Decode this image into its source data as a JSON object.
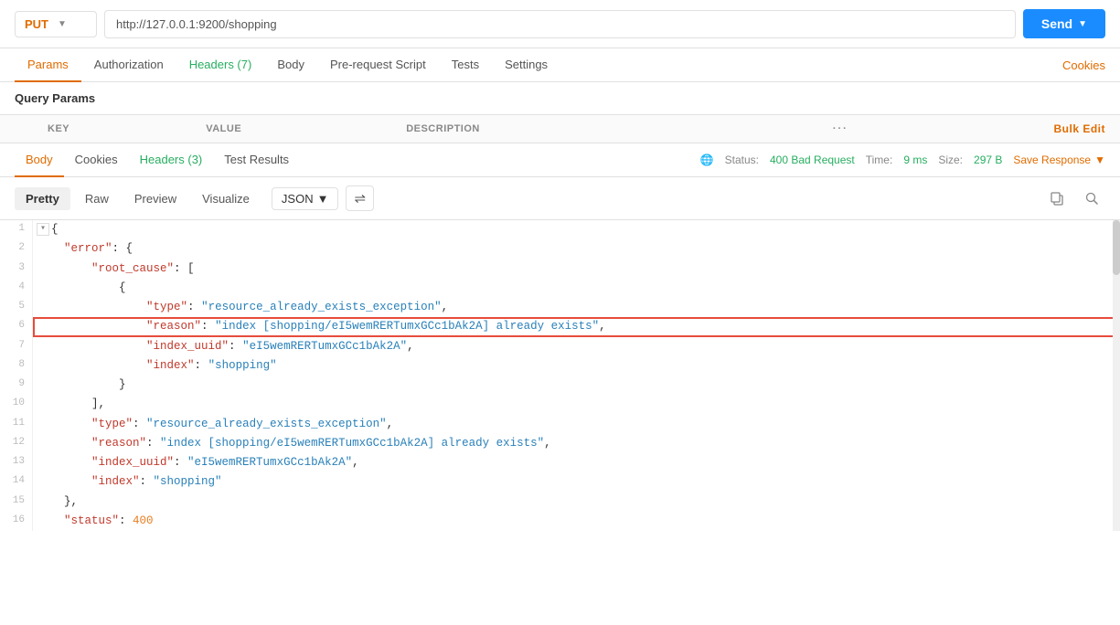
{
  "url_bar": {
    "method": "PUT",
    "url": "http://127.0.0.1:9200/shopping",
    "send_label": "Send"
  },
  "top_tabs": {
    "items": [
      {
        "label": "Params",
        "active": true
      },
      {
        "label": "Authorization"
      },
      {
        "label": "Headers (7)",
        "green": true
      },
      {
        "label": "Body"
      },
      {
        "label": "Pre-request Script"
      },
      {
        "label": "Tests"
      },
      {
        "label": "Settings"
      }
    ],
    "cookies_label": "Cookies"
  },
  "query_params": {
    "section_label": "Query Params",
    "columns": {
      "key": "KEY",
      "value": "VALUE",
      "description": "DESCRIPTION",
      "bulk_edit": "Bulk Edit"
    }
  },
  "response_tabs": {
    "items": [
      {
        "label": "Body",
        "active": true
      },
      {
        "label": "Cookies"
      },
      {
        "label": "Headers (3)",
        "green": true
      },
      {
        "label": "Test Results"
      }
    ],
    "status_label": "Status:",
    "status_value": "400 Bad Request",
    "time_label": "Time:",
    "time_value": "9 ms",
    "size_label": "Size:",
    "size_value": "297 B",
    "save_response_label": "Save Response"
  },
  "format_bar": {
    "tabs": [
      {
        "label": "Pretty",
        "active": true
      },
      {
        "label": "Raw"
      },
      {
        "label": "Preview"
      },
      {
        "label": "Visualize"
      }
    ],
    "format_dropdown": "JSON"
  },
  "json_lines": [
    {
      "num": 1,
      "content": "{",
      "type": "plain",
      "fold": true
    },
    {
      "num": 2,
      "content": "    \"error\": {",
      "type": "plain"
    },
    {
      "num": 3,
      "content": "        \"root_cause\": [",
      "type": "plain"
    },
    {
      "num": 4,
      "content": "            {",
      "type": "plain"
    },
    {
      "num": 5,
      "content": "                \"type\": \"resource_already_exists_exception\",",
      "type": "plain"
    },
    {
      "num": 6,
      "content": "                \"reason\": \"index [shopping/eI5wemRERTumxGCc1bAk2A] already exists\",",
      "type": "highlighted"
    },
    {
      "num": 7,
      "content": "                \"index_uuid\": \"eI5wemRERTumxGCc1bAk2A\",",
      "type": "plain"
    },
    {
      "num": 8,
      "content": "                \"index\": \"shopping\"",
      "type": "plain"
    },
    {
      "num": 9,
      "content": "            }",
      "type": "plain"
    },
    {
      "num": 10,
      "content": "        ],",
      "type": "plain"
    },
    {
      "num": 11,
      "content": "        \"type\": \"resource_already_exists_exception\",",
      "type": "plain"
    },
    {
      "num": 12,
      "content": "        \"reason\": \"index [shopping/eI5wemRERTumxGCc1bAk2A] already exists\",",
      "type": "plain"
    },
    {
      "num": 13,
      "content": "        \"index_uuid\": \"eI5wemRERTumxGCc1bAk2A\",",
      "type": "plain"
    },
    {
      "num": 14,
      "content": "        \"index\": \"shopping\"",
      "type": "plain"
    },
    {
      "num": 15,
      "content": "    },",
      "type": "plain"
    },
    {
      "num": 16,
      "content": "    \"status\": 400",
      "type": "status"
    }
  ]
}
